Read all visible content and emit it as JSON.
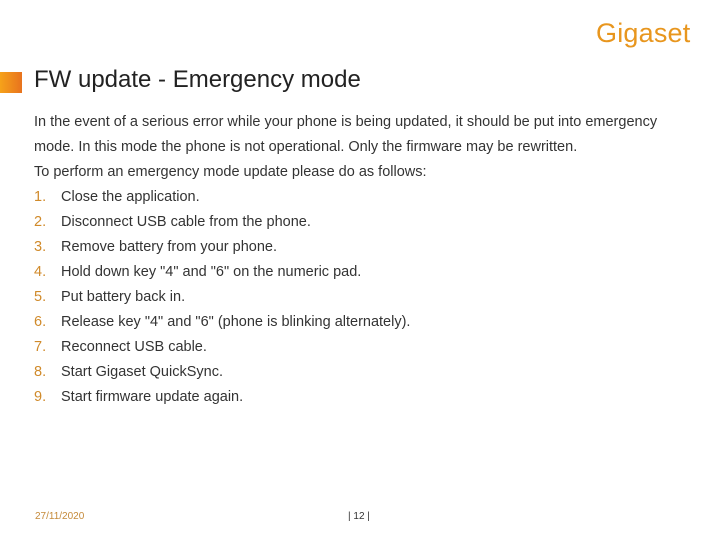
{
  "brand": {
    "logo": "Gigaset",
    "accent": "#e8961e"
  },
  "title": "FW update - Emergency mode",
  "intro": [
    "In the event of a serious error while your phone is being updated, it should be put into emergency mode. In this mode the phone is not operational. Only the firmware may be rewritten.",
    "To perform an emergency mode update please do as follows:"
  ],
  "steps": [
    {
      "num": "1.",
      "text": "Close the application."
    },
    {
      "num": "2.",
      "text": "Disconnect USB cable from the phone."
    },
    {
      "num": "3.",
      "text": "Remove battery from your phone."
    },
    {
      "num": "4.",
      "text": "Hold down key \"4\" and \"6\" on the numeric pad."
    },
    {
      "num": "5.",
      "text": "Put battery back in."
    },
    {
      "num": "6.",
      "text": "Release key \"4\" and \"6\" (phone is blinking alternately)."
    },
    {
      "num": "7.",
      "text": "Reconnect USB cable."
    },
    {
      "num": "8.",
      "text": "Start Gigaset QuickSync."
    },
    {
      "num": "9.",
      "text": "Start firmware update again."
    }
  ],
  "footer": {
    "date": "27/11/2020",
    "page": "| 12 |"
  }
}
